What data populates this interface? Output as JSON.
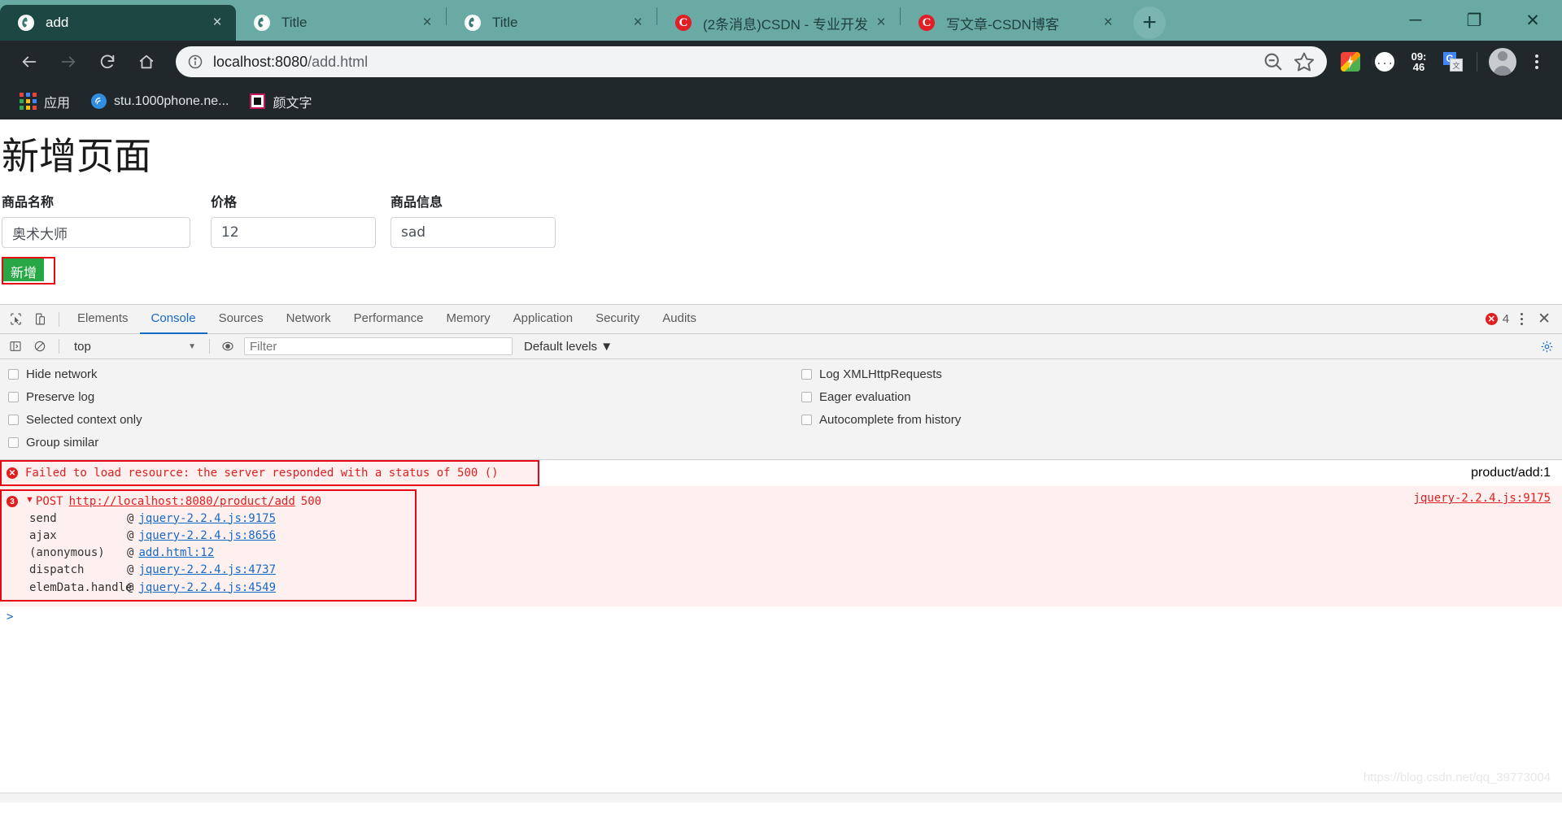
{
  "browser": {
    "tabs": [
      {
        "title": "add",
        "icon": "globe-icon",
        "active": true,
        "close": "×"
      },
      {
        "title": "Title",
        "icon": "globe-icon",
        "active": false,
        "close": "×"
      },
      {
        "title": "Title",
        "icon": "globe-icon",
        "active": false,
        "close": "×"
      },
      {
        "title": "(2条消息)CSDN - 专业开发",
        "icon": "csdn-icon",
        "active": false,
        "close": "×"
      },
      {
        "title": "写文章-CSDN博客",
        "icon": "csdn-icon",
        "active": false,
        "close": "×"
      }
    ],
    "new_tab_label": "+",
    "window_controls": {
      "minimize": "─",
      "maximize": "❐",
      "close": "✕"
    },
    "toolbar": {
      "back": "back-arrow",
      "forward": "forward-arrow",
      "reload": "reload-icon",
      "home": "home-icon",
      "url_scheme_prefix": "localhost:8080",
      "url_path": "/add.html",
      "url_full": "localhost:8080/add.html",
      "zoom_out_label": "zoom-out-icon",
      "bookmark_label": "star-icon",
      "extension_time": "09:\n46",
      "extension_time_top": "09:",
      "extension_time_bottom": "46",
      "braces_label": "{...}",
      "translate_g": "G"
    },
    "bookmarks": [
      {
        "label": "应用",
        "icon": "apps-grid-icon"
      },
      {
        "label": "stu.1000phone.ne...",
        "icon": "circle-logo-icon"
      },
      {
        "label": "颜文字",
        "icon": "square-logo-icon"
      }
    ]
  },
  "page": {
    "title": "新增页面",
    "fields": [
      {
        "label": "商品名称",
        "value": "奥术大师"
      },
      {
        "label": "价格",
        "value": "12"
      },
      {
        "label": "商品信息",
        "value": "sad"
      }
    ],
    "submit_label": "新增"
  },
  "devtools": {
    "tabs": [
      "Elements",
      "Console",
      "Sources",
      "Network",
      "Performance",
      "Memory",
      "Application",
      "Security",
      "Audits"
    ],
    "active_tab": "Console",
    "error_count": "4",
    "close_label": "✕",
    "filterbar": {
      "context": "top",
      "context_caret": "▼",
      "filter_placeholder": "Filter",
      "filter_value": "",
      "levels": "Default levels ▼"
    },
    "settings_left": [
      "Hide network",
      "Preserve log",
      "Selected context only",
      "Group similar"
    ],
    "settings_right": [
      "Log XMLHttpRequests",
      "Eager evaluation",
      "Autocomplete from history"
    ],
    "messages": [
      {
        "type": "error",
        "icon_label": "✕",
        "text": "Failed to load resource: the server responded with a status of 500 ()",
        "source": "product/add:1"
      }
    ],
    "stack_group": {
      "badge": "3",
      "triangle": "▼",
      "method": "POST",
      "url": "http://localhost:8080/product/add",
      "status": "500",
      "source": "jquery-2.2.4.js:9175",
      "frames": [
        {
          "fn": "send",
          "at": "@",
          "loc": "jquery-2.2.4.js:9175"
        },
        {
          "fn": "ajax",
          "at": "@",
          "loc": "jquery-2.2.4.js:8656"
        },
        {
          "fn": "(anonymous)",
          "at": "@",
          "loc": "add.html:12"
        },
        {
          "fn": "dispatch",
          "at": "@",
          "loc": "jquery-2.2.4.js:4737"
        },
        {
          "fn": "elemData.handle",
          "at": "@",
          "loc": "jquery-2.2.4.js:4549"
        }
      ]
    },
    "prompt": ">"
  },
  "watermark": "https://blog.csdn.net/qq_39773004",
  "colors": {
    "tab_active": "#1d4742",
    "tab_inactive": "#69aaa4",
    "toolbar": "#21282b",
    "accent_blue": "#1769c6",
    "error_red": "#e02020",
    "highlight_red": "#e50914",
    "success_green": "#28a745"
  }
}
